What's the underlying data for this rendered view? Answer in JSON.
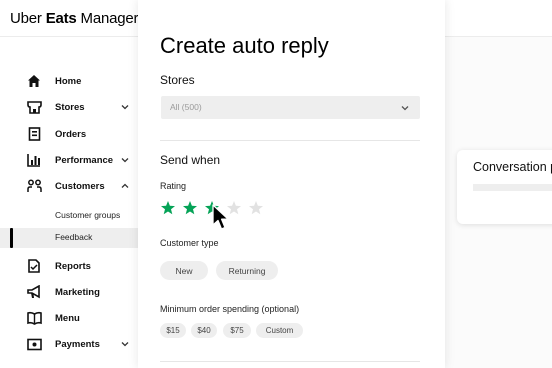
{
  "brand": {
    "name_regular": "Uber ",
    "name_bold": "Eats",
    "name_suffix": " Manager"
  },
  "sidebar": {
    "items": [
      {
        "label": "Home",
        "icon": "home-icon"
      },
      {
        "label": "Stores",
        "icon": "store-icon",
        "chevron": "down"
      },
      {
        "label": "Orders",
        "icon": "orders-icon"
      },
      {
        "label": "Performance",
        "icon": "bar-chart-icon",
        "chevron": "down"
      },
      {
        "label": "Customers",
        "icon": "customers-icon",
        "chevron": "up"
      },
      {
        "label": "Reports",
        "icon": "reports-icon"
      },
      {
        "label": "Marketing",
        "icon": "megaphone-icon"
      },
      {
        "label": "Menu",
        "icon": "book-icon"
      },
      {
        "label": "Payments",
        "icon": "payments-icon",
        "chevron": "down"
      }
    ],
    "sub_items": [
      {
        "label": "Customer groups"
      },
      {
        "label": "Feedback",
        "active": true
      }
    ]
  },
  "panel": {
    "title": "Create auto reply",
    "stores_label": "Stores",
    "stores_select": {
      "value": "All (500)"
    },
    "send_when_label": "Send when",
    "rating_label": "Rating",
    "rating": {
      "selected": 3,
      "max": 5,
      "filled_color": "#05a357",
      "empty_color": "#e2e2e2"
    },
    "customer_type_label": "Customer type",
    "customer_types": [
      "New",
      "Returning"
    ],
    "min_order_label": "Minimum order spending (optional)",
    "min_order_options": [
      "$15",
      "$40",
      "$75",
      "Custom"
    ]
  },
  "right_card": {
    "title": "Conversation p"
  },
  "colors": {
    "accent": "#05a357",
    "text": "#000000",
    "chip_bg": "#eeeeee"
  }
}
